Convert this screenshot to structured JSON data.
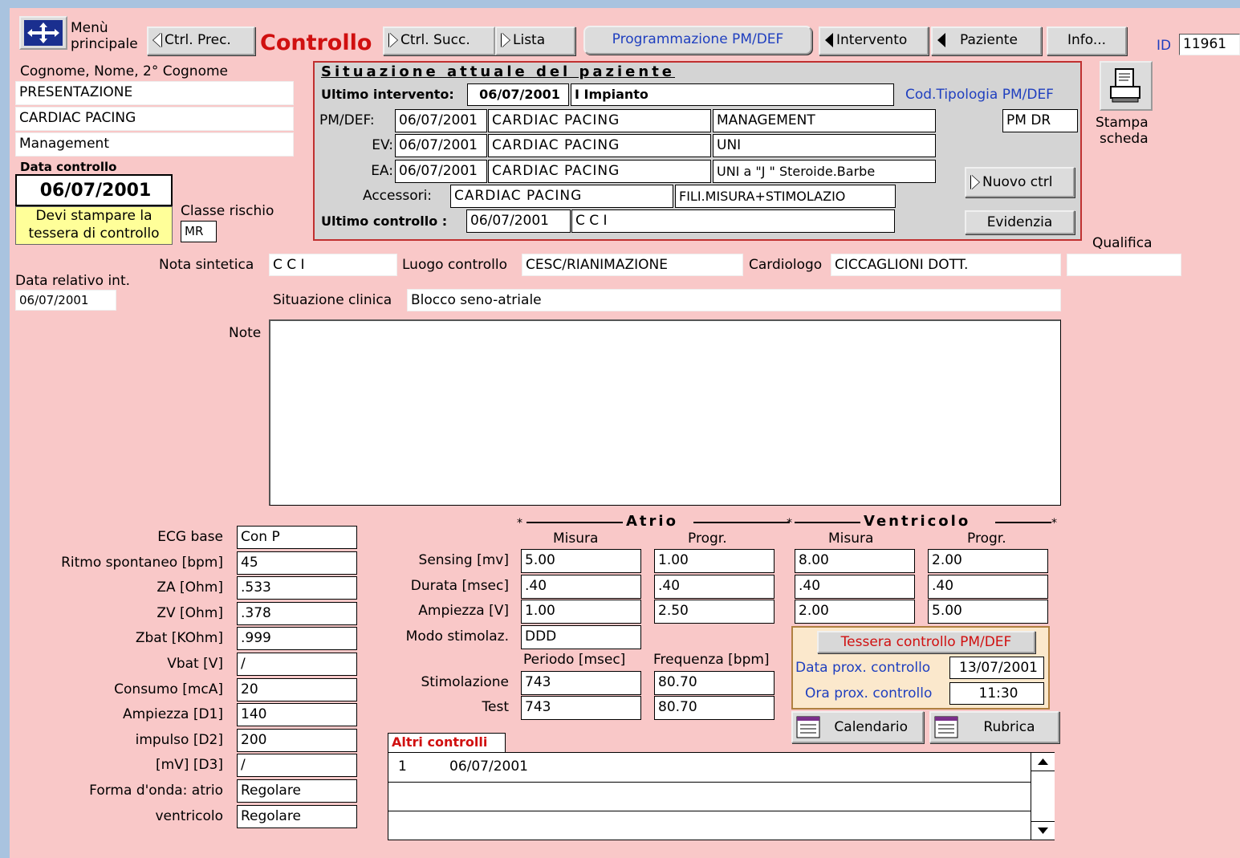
{
  "toolbar": {
    "menu_label_1": "Menù",
    "menu_label_2": "principale",
    "prev": "Ctrl. Prec.",
    "title": "Controllo",
    "next": "Ctrl. Succ.",
    "lista": "Lista",
    "programmazione": "Programmazione PM/DEF",
    "intervento": "Intervento",
    "paziente": "Paziente",
    "info": "Info...",
    "id_label": "ID",
    "id_value": "11961"
  },
  "patient": {
    "name_label": "Cognome, Nome, 2° Cognome",
    "line1": "PRESENTAZIONE",
    "line2": " CARDIAC  PACING",
    "line3": "Management",
    "data_controllo_label": "Data controllo",
    "data_controllo": "06/07/2001",
    "warning_line1": "Devi stampare la",
    "warning_line2": "tessera di controllo",
    "classe_label": "Classe rischio",
    "classe_value": "MR"
  },
  "situazione": {
    "title": "Situazione attuale del paziente",
    "ultimo_int_label": "Ultimo intervento:",
    "ultimo_int_date": "06/07/2001",
    "ultimo_int_type": "I Impianto",
    "cod_label": "Cod.Tipologia PM/DEF",
    "cod_value": "PM DR",
    "pmdef_label": "PM/DEF:",
    "pmdef_date": "06/07/2001",
    "pmdef_maker": "CARDIAC PACING",
    "pmdef_model": "MANAGEMENT",
    "ev_label": "EV:",
    "ev_date": "06/07/2001",
    "ev_maker": "CARDIAC PACING",
    "ev_model": "UNI",
    "ea_label": "EA:",
    "ea_date": "06/07/2001",
    "ea_maker": "CARDIAC PACING",
    "ea_model": "UNI a  \"J \" Steroide.Barbe",
    "acc_label": "Accessori:",
    "acc_maker": "CARDIAC PACING",
    "acc_model": "FILI.MISURA+STIMOLAZIO",
    "ultimo_ctrl_label": "Ultimo controllo :",
    "ultimo_ctrl_date": "06/07/2001",
    "ultimo_ctrl_note": "C C I",
    "nuovo_btn": "Nuovo ctrl",
    "evidenzia_btn": "Evidenzia"
  },
  "stampa": {
    "line1": "Stampa",
    "line2": "scheda"
  },
  "qualifica_label": "Qualifica",
  "qualifica_value": "",
  "nota_label": "Nota sintetica",
  "nota_value": "C C I",
  "luogo_label": "Luogo controllo",
  "luogo_value": "CESC/RIANIMAZIONE",
  "cardiologo_label": "Cardiologo",
  "cardiologo_value": "CICCAGLIONI DOTT.",
  "data_rel_label": "Data relativo int.",
  "data_rel_value": "06/07/2001",
  "situazione_clinica_label": "Situazione clinica",
  "situazione_clinica_value": "Blocco seno-atriale",
  "note_label": "Note",
  "note_value": "",
  "left_params": [
    {
      "label": "ECG base",
      "value": "Con P"
    },
    {
      "label": "Ritmo spontaneo [bpm]",
      "value": "45"
    },
    {
      "label": "ZA [Ohm]",
      "value": ".533"
    },
    {
      "label": "ZV [Ohm]",
      "value": ".378"
    },
    {
      "label": "Zbat [KOhm]",
      "value": ".999"
    },
    {
      "label": "Vbat [V]",
      "value": "/"
    },
    {
      "label": "Consumo [mcA]",
      "value": "20"
    },
    {
      "label": "Ampiezza [D1]",
      "value": "140"
    },
    {
      "label": "impulso [D2]",
      "value": "200"
    },
    {
      "label": "[mV] [D3]",
      "value": "/"
    },
    {
      "label": "Forma d'onda: atrio",
      "value": "Regolare"
    },
    {
      "label": "ventricolo",
      "value": "Regolare"
    }
  ],
  "atrio_header": "Atrio",
  "ventricolo_header": "Ventricolo",
  "col_misura": "Misura",
  "col_progr": "Progr.",
  "measures": {
    "sensing": {
      "label": "Sensing [mv]",
      "a_mis": "5.00",
      "a_prog": "1.00",
      "v_mis": "8.00",
      "v_prog": "2.00"
    },
    "durata": {
      "label": "Durata [msec]",
      "a_mis": ".40",
      "a_prog": ".40",
      "v_mis": ".40",
      "v_prog": ".40"
    },
    "ampiezza": {
      "label": "Ampiezza [V]",
      "a_mis": "1.00",
      "a_prog": "2.50",
      "v_mis": "2.00",
      "v_prog": "5.00"
    }
  },
  "modo_label": "Modo stimolaz.",
  "modo_value": "DDD",
  "periodo_label": "Periodo [msec]",
  "frequenza_label": "Frequenza [bpm]",
  "stim_label": "Stimolazione",
  "stim_periodo": "743",
  "stim_freq": "80.70",
  "test_label": "Test",
  "test_periodo": "743",
  "test_freq": "80.70",
  "tessera": {
    "button": "Tessera controllo PM/DEF",
    "data_label": "Data prox. controllo",
    "data_value": "13/07/2001",
    "ora_label": "Ora prox. controllo",
    "ora_value": "11:30",
    "calendario": "Calendario",
    "rubrica": "Rubrica"
  },
  "altri": {
    "title": "Altri controlli",
    "rows": [
      {
        "n": "1",
        "date": "06/07/2001"
      }
    ]
  },
  "colors": {
    "background": "#f9c8c8",
    "panel_border": "#c03030",
    "link_blue": "#1f3fbf",
    "title_red": "#d01010"
  }
}
